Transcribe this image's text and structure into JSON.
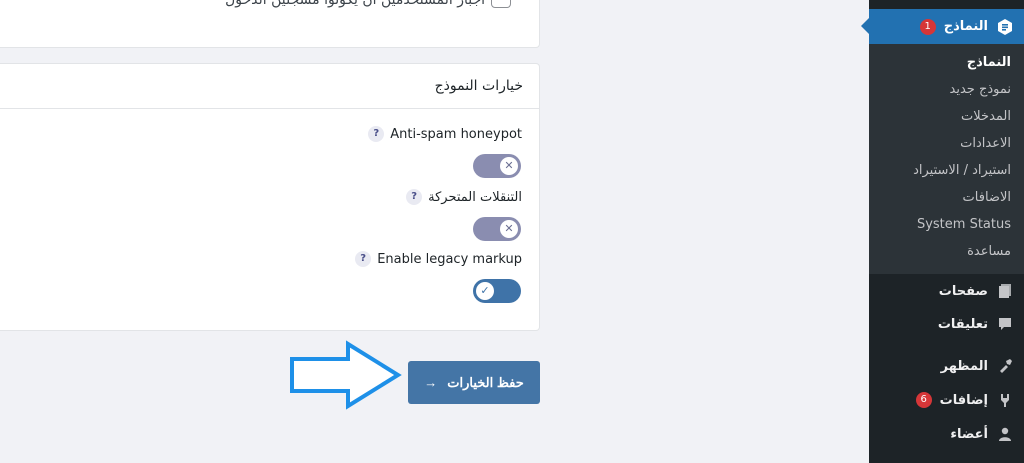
{
  "top_card": {
    "cut_text": "أجبار المستخدمين أن يكونوا مسجلين الدخول"
  },
  "form_options": {
    "title": "خيارات النموذج",
    "help_glyph": "?",
    "options": [
      {
        "label": "Anti-spam honeypot",
        "state": "off",
        "knob_glyph": "✕"
      },
      {
        "label": "التنقلات المتحركة",
        "state": "off",
        "knob_glyph": "✕"
      },
      {
        "label": "Enable legacy markup",
        "state": "on",
        "knob_glyph": "✓"
      }
    ]
  },
  "save_button": {
    "label": "حفظ الخيارات",
    "arrow": "→"
  },
  "sidebar": {
    "active": {
      "label": "النماذج",
      "badge": "1",
      "icon": "forms-icon"
    },
    "submenu": [
      {
        "label": "النماذج",
        "current": true
      },
      {
        "label": "نموذج جديد",
        "current": false
      },
      {
        "label": "المدخلات",
        "current": false
      },
      {
        "label": "الاعدادات",
        "current": false
      },
      {
        "label": "استيراد / الاستيراد",
        "current": false
      },
      {
        "label": "الاضافات",
        "current": false
      },
      {
        "label": "System Status",
        "current": false
      },
      {
        "label": "مساعدة",
        "current": false
      }
    ],
    "menu": [
      {
        "label": "صفحات",
        "icon": "pages-icon"
      },
      {
        "label": "تعليقات",
        "icon": "comments-icon"
      },
      {
        "label": "المظهر",
        "icon": "appearance-icon"
      },
      {
        "label": "إضافات",
        "icon": "plugins-icon",
        "badge": "6"
      },
      {
        "label": "أعضاء",
        "icon": "users-icon"
      }
    ]
  },
  "colors": {
    "sidebar_bg": "#1d2327",
    "submenu_bg": "#2c3338",
    "active_blue": "#2271b1",
    "save_button": "#4475a6",
    "toggle_off": "#8a8db0",
    "toggle_on": "#3f73a8",
    "annotation_arrow": "#1e90e8"
  }
}
